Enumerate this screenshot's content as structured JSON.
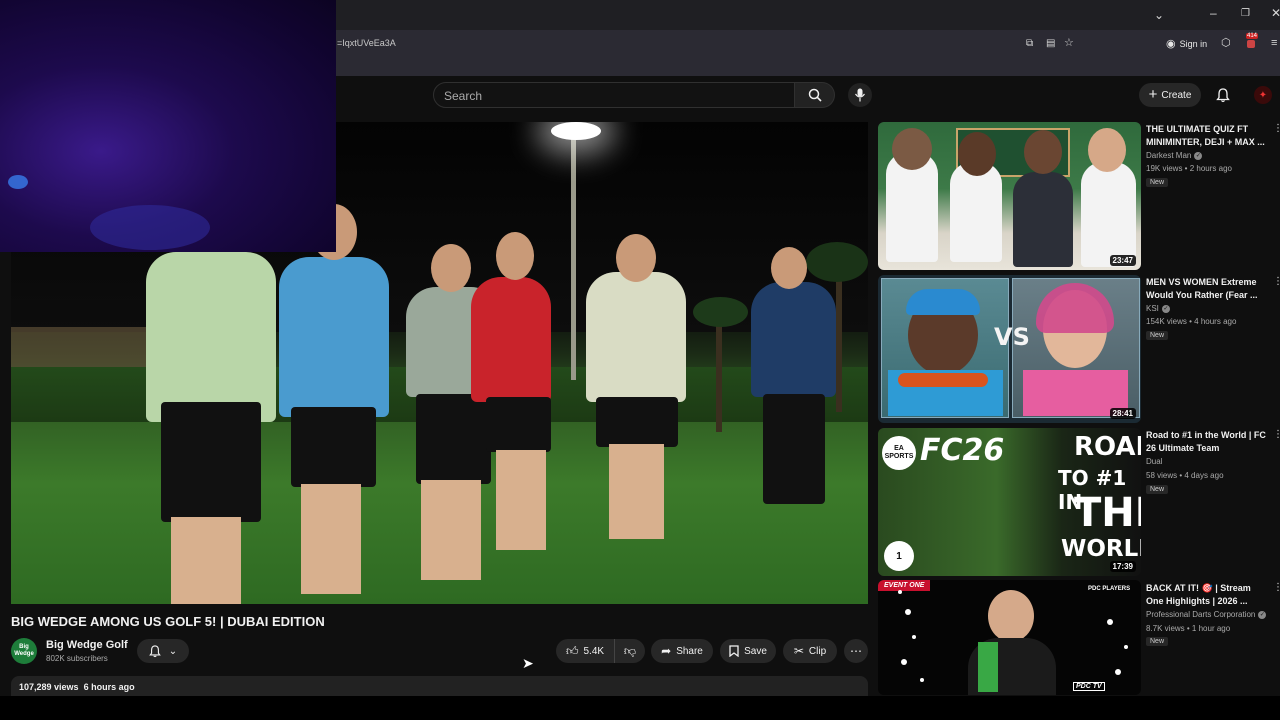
{
  "browser": {
    "url": "=IqxtUVeEa3A",
    "sign_in": "Sign in",
    "extension_badge": "414"
  },
  "header": {
    "search_placeholder": "Search",
    "create_label": "Create"
  },
  "video": {
    "title": "BIG WEDGE AMONG US GOLF 5! | DUBAI EDITION",
    "channel": "Big Wedge Golf",
    "channel_avatar_text": "Big Wedge",
    "subscribers": "802K subscribers",
    "likes": "5.4K",
    "share_label": "Share",
    "save_label": "Save",
    "clip_label": "Clip",
    "views": "107,289 views",
    "posted": "6 hours ago"
  },
  "recommendations": [
    {
      "title": "THE ULTIMATE QUIZ FT MINIMINTER, DEJI + MAX ...",
      "channel": "Darkest Man",
      "meta": "19K views • 2 hours ago",
      "badge": "New",
      "duration": "23:47"
    },
    {
      "title": "MEN VS WOMEN Extreme Would You Rather (Fear ...",
      "channel": "KSI",
      "meta": "154K views • 4 hours ago",
      "badge": "New",
      "duration": "28:41",
      "thumb_text": "VS"
    },
    {
      "title": "Road to #1 in the World | FC 26 Ultimate Team",
      "channel": "Dual",
      "meta": "58 views • 4 days ago",
      "badge": "New",
      "duration": "17:39",
      "thumb_logo": "FC26",
      "thumb_brand": "EA SPORTS",
      "thumb_line1": "ROAD",
      "thumb_line2": "TO #1 IN",
      "thumb_line3": "THE",
      "thumb_line4": "WORLD",
      "thumb_rank": "1"
    },
    {
      "title": "BACK AT IT! 🎯 | Stream One Highlights | 2026 ...",
      "channel": "Professional Darts Corporation",
      "meta": "8.7K views • 1 hour ago",
      "badge": "New",
      "thumb_tag": "EVENT ONE",
      "thumb_brand": "PDC PLAYERS",
      "thumb_tv": "PDC TV"
    }
  ],
  "colors": {
    "background": "#0f0f0f",
    "surface": "#272727",
    "accent_red": "#e33333",
    "text": "#f1f1f1",
    "muted": "#aaaaaa"
  }
}
